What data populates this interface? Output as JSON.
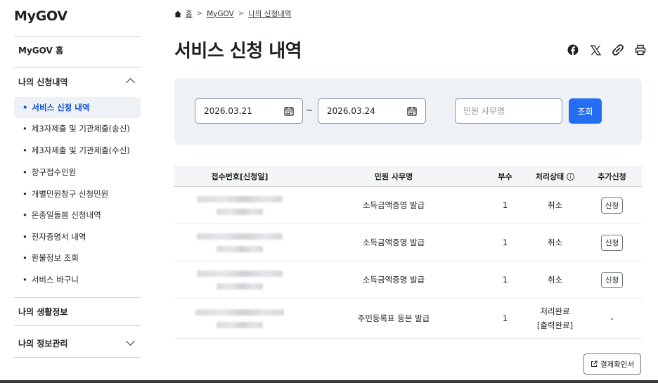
{
  "sidebar": {
    "brand": "MyGOV",
    "home": "MyGOV 홈",
    "section_applications": "나의 신청내역",
    "items": [
      {
        "label": "서비스 신청 내역",
        "active": true
      },
      {
        "label": "제3자제출 및 기관제출(송신)"
      },
      {
        "label": "제3자제출 및 기관제출(수신)"
      },
      {
        "label": "창구접수민원"
      },
      {
        "label": "개별민원창구 신청민원"
      },
      {
        "label": "온종일돌봄 신청내역"
      },
      {
        "label": "전자증명서 내역"
      },
      {
        "label": "환불정보 조회"
      },
      {
        "label": "서비스 바구니"
      }
    ],
    "section_life": "나의 생활정보",
    "section_info": "나의 정보관리"
  },
  "breadcrumb": {
    "home": "홈",
    "mygov": "MyGOV",
    "current": "나의 신청내역"
  },
  "page_title": "서비스 신청 내역",
  "share_icons": [
    "facebook-icon",
    "x-icon",
    "link-icon",
    "print-icon"
  ],
  "filter": {
    "start_date": "2026.03.21",
    "separator": "~",
    "end_date": "2026.03.24",
    "search_placeholder": "민원 사무명",
    "search_label": "조회"
  },
  "table": {
    "headers": {
      "receipt_no": "접수번호[신청일]",
      "service_name": "민원 사무명",
      "copies": "부수",
      "status": "처리상태",
      "extra": "추가신청"
    },
    "rows": [
      {
        "service": "소득금액증명 발급",
        "copies": "1",
        "status": "취소",
        "status_sub": "",
        "action": "신청"
      },
      {
        "service": "소득금액증명 발급",
        "copies": "1",
        "status": "취소",
        "status_sub": "",
        "action": "신청"
      },
      {
        "service": "소득금액증명 발급",
        "copies": "1",
        "status": "취소",
        "status_sub": "",
        "action": "신청"
      },
      {
        "service": "주민등록표 등본 발급",
        "copies": "1",
        "status": "처리완료",
        "status_sub": "[출력완료]",
        "action": "-"
      }
    ]
  },
  "receipt_button": "결제확인서",
  "colors": {
    "primary": "#256ef4",
    "active_text": "#0b50d0",
    "filter_bg": "#eef2f7"
  }
}
